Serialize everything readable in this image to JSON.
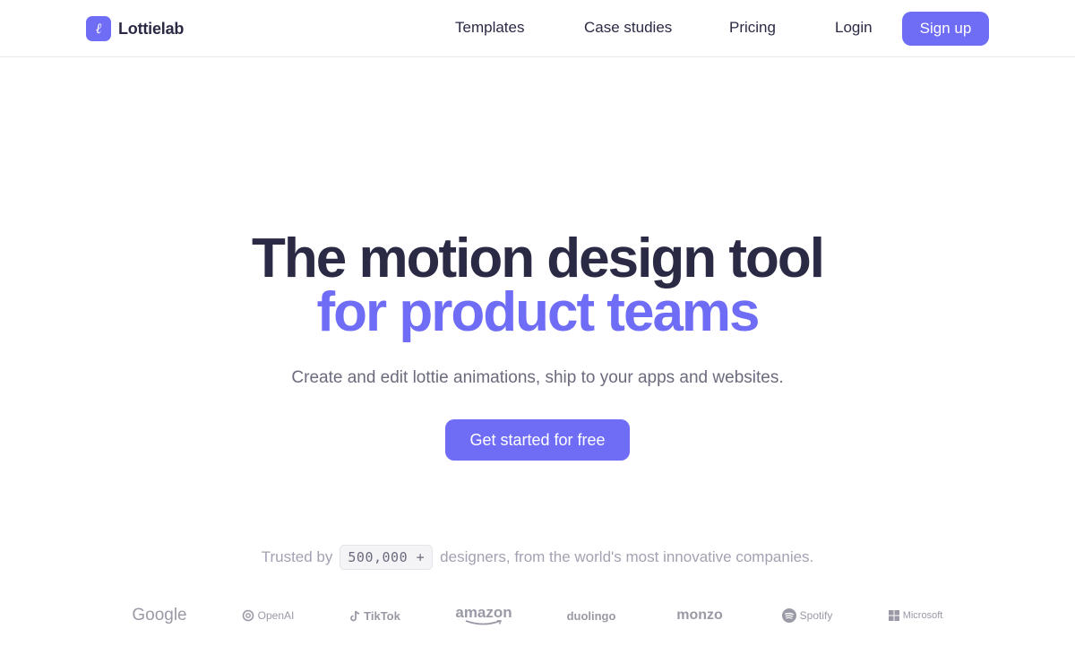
{
  "brand": {
    "name": "Lottielab",
    "mark_glyph": "ℓ"
  },
  "nav": {
    "links": [
      "Templates",
      "Case studies",
      "Pricing",
      "Login"
    ],
    "signup_label": "Sign up"
  },
  "hero": {
    "title_line_1": "The motion design tool",
    "title_line_2": "for product teams",
    "subtitle": "Create and edit lottie animations, ship to your apps and websites.",
    "cta_label": "Get started for free"
  },
  "trusted": {
    "prefix": "Trusted by",
    "count": "500,000 +",
    "suffix": "designers, from the world's most innovative companies."
  },
  "logos": [
    "Google",
    "OpenAI",
    "TikTok",
    "amazon",
    "duolingo",
    "monzo",
    "Spotify",
    "Microsoft"
  ],
  "colors": {
    "accent": "#6f6cf6",
    "heading": "#2b2a45",
    "muted": "#6b6b7e",
    "logo": "#9a9aa6"
  }
}
